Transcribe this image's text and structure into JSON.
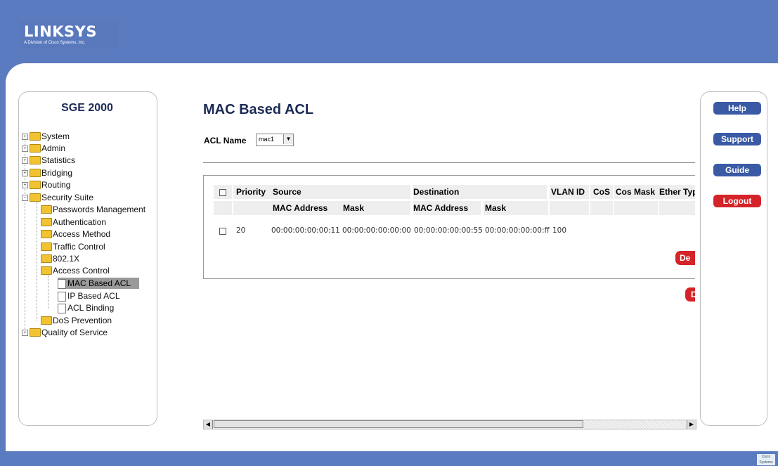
{
  "header": {
    "logo": "LINKSYS",
    "logo_sub": "A Division of Cisco Systems, Inc."
  },
  "sidebar": {
    "title": "SGE 2000",
    "items": [
      {
        "label": "System"
      },
      {
        "label": "Admin"
      },
      {
        "label": "Statistics"
      },
      {
        "label": "Bridging"
      },
      {
        "label": "Routing"
      },
      {
        "label": "Security Suite"
      },
      {
        "label": "Passwords Management"
      },
      {
        "label": "Authentication"
      },
      {
        "label": "Access Method"
      },
      {
        "label": "Traffic Control"
      },
      {
        "label": "802.1X"
      },
      {
        "label": "Access Control"
      },
      {
        "label": "MAC Based ACL"
      },
      {
        "label": "IP Based ACL"
      },
      {
        "label": "ACL Binding"
      },
      {
        "label": "DoS Prevention"
      },
      {
        "label": "Quality of Service"
      }
    ]
  },
  "main": {
    "title": "MAC Based ACL",
    "acl_name_label": "ACL Name",
    "acl_name_value": "mac1",
    "table": {
      "headers": {
        "priority": "Priority",
        "source": "Source",
        "destination": "Destination",
        "vlan_id": "VLAN ID",
        "cos": "CoS",
        "cos_mask": "Cos Mask",
        "ether_type": "Ether Typ"
      },
      "subheaders": {
        "src_mac": "MAC Address",
        "src_mask": "Mask",
        "dst_mac": "MAC Address",
        "dst_mask": "Mask"
      },
      "rows": [
        {
          "priority": "20",
          "src_mac": "00:00:00:00:00:11",
          "src_mask": "00:00:00:00:00:00",
          "dst_mac": "00:00:00:00:00:55",
          "dst_mask": "00:00:00:00:00:ff",
          "vlan_id": "100"
        }
      ]
    },
    "delete_button": "De",
    "delete_button2": "D"
  },
  "right_panel": {
    "help": "Help",
    "support": "Support",
    "guide": "Guide",
    "logout": "Logout"
  },
  "colors": {
    "header_blue": "#5a7bbf",
    "title_navy": "#1c2b55",
    "button_blue": "#3a5aa5",
    "button_red": "#d5232a"
  }
}
